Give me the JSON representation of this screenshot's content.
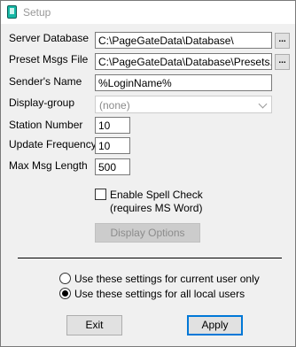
{
  "window": {
    "title": "Setup"
  },
  "fields": {
    "server_database": {
      "label": "Server Database",
      "value": "C:\\PageGateData\\Database\\",
      "browse": "..."
    },
    "preset_msgs_file": {
      "label": "Preset Msgs File",
      "value": "C:\\PageGateData\\Database\\Presets.txt",
      "browse": "..."
    },
    "senders_name": {
      "label": "Sender's Name",
      "value": "%LoginName%"
    },
    "display_group": {
      "label": "Display-group",
      "selected": "(none)"
    },
    "station_number": {
      "label": "Station Number",
      "value": "10"
    },
    "update_frequency": {
      "label": "Update Frequency",
      "value": "10"
    },
    "max_msg_length": {
      "label": "Max Msg Length",
      "value": "500"
    }
  },
  "spell_check": {
    "label_line1": "Enable Spell Check",
    "label_line2": "(requires MS Word)",
    "checked": false
  },
  "display_options_button": "Display Options",
  "scope": {
    "options": [
      {
        "label": "Use these settings for current user only",
        "checked": false
      },
      {
        "label": "Use these settings for all local users",
        "checked": true
      }
    ]
  },
  "buttons": {
    "exit": "Exit",
    "apply": "Apply"
  }
}
